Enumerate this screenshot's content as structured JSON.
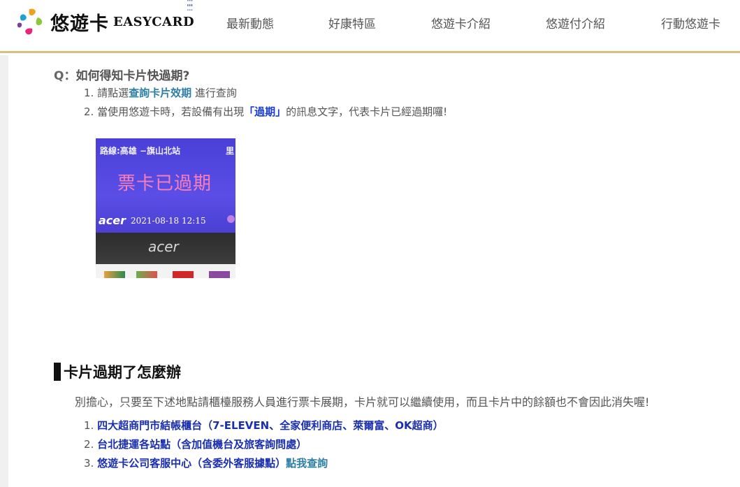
{
  "header": {
    "logo_cn": "悠遊卡",
    "logo_en": "EASYCARD",
    "menu_icon": "grid-dots-icon",
    "nav": [
      {
        "label": "最新動態"
      },
      {
        "label": "好康特區"
      },
      {
        "label": "悠遊卡介紹"
      },
      {
        "label": "悠遊付介紹"
      },
      {
        "label": "行動悠遊卡"
      }
    ]
  },
  "faq": {
    "question_prefix": "Q：",
    "question": "如何得知卡片快過期?",
    "item1_num": "1.",
    "item1_pre": "請點選",
    "item1_link": "查詢卡片效期",
    "item1_post": " 進行查詢",
    "item2_num": "2.",
    "item2_pre": "當使用悠遊卡時，若設備有出現",
    "item2_highlight": "「過期」",
    "item2_post": "的訊息文字，代表卡片已經過期囉!"
  },
  "photo": {
    "route": "路線:高雄 −旗山北站",
    "route_extra": "里",
    "message": "票卡已過期",
    "brand": "acer",
    "datetime": "2021-08-18  12:15",
    "bezel_brand": "acer"
  },
  "section": {
    "title": "卡片過期了怎麼辦",
    "description": "別擔心，只要至下述地點請櫃檯服務人員進行票卡展期，卡片就可以繼續使用，而且卡片中的餘額也不會因此消失喔!",
    "locations": [
      {
        "num": "1.",
        "text": "四大超商門市結帳櫃台（7-ELEVEN、全家便利商店、萊爾富、OK超商）",
        "link": ""
      },
      {
        "num": "2.",
        "text": "台北捷運各站點（含加值機台及旅客詢問處）",
        "link": ""
      },
      {
        "num": "3.",
        "text": "悠遊卡公司客服中心（含委外客服據點）",
        "link": "點我查詢"
      }
    ]
  },
  "colors": {
    "header_border": "#d9c07a",
    "link": "#2d7fa6",
    "location_text": "#1a2fae",
    "highlight": "#1a3dd6"
  }
}
